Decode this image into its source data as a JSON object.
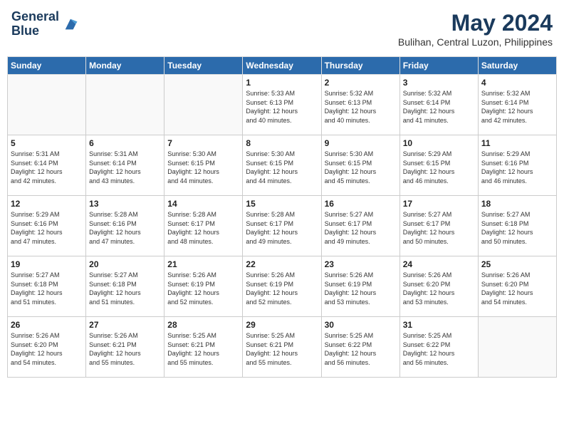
{
  "header": {
    "logo_line1": "General",
    "logo_line2": "Blue",
    "month": "May 2024",
    "location": "Bulihan, Central Luzon, Philippines"
  },
  "days_of_week": [
    "Sunday",
    "Monday",
    "Tuesday",
    "Wednesday",
    "Thursday",
    "Friday",
    "Saturday"
  ],
  "weeks": [
    [
      {
        "day": "",
        "info": ""
      },
      {
        "day": "",
        "info": ""
      },
      {
        "day": "",
        "info": ""
      },
      {
        "day": "1",
        "info": "Sunrise: 5:33 AM\nSunset: 6:13 PM\nDaylight: 12 hours\nand 40 minutes."
      },
      {
        "day": "2",
        "info": "Sunrise: 5:32 AM\nSunset: 6:13 PM\nDaylight: 12 hours\nand 40 minutes."
      },
      {
        "day": "3",
        "info": "Sunrise: 5:32 AM\nSunset: 6:14 PM\nDaylight: 12 hours\nand 41 minutes."
      },
      {
        "day": "4",
        "info": "Sunrise: 5:32 AM\nSunset: 6:14 PM\nDaylight: 12 hours\nand 42 minutes."
      }
    ],
    [
      {
        "day": "5",
        "info": "Sunrise: 5:31 AM\nSunset: 6:14 PM\nDaylight: 12 hours\nand 42 minutes."
      },
      {
        "day": "6",
        "info": "Sunrise: 5:31 AM\nSunset: 6:14 PM\nDaylight: 12 hours\nand 43 minutes."
      },
      {
        "day": "7",
        "info": "Sunrise: 5:30 AM\nSunset: 6:15 PM\nDaylight: 12 hours\nand 44 minutes."
      },
      {
        "day": "8",
        "info": "Sunrise: 5:30 AM\nSunset: 6:15 PM\nDaylight: 12 hours\nand 44 minutes."
      },
      {
        "day": "9",
        "info": "Sunrise: 5:30 AM\nSunset: 6:15 PM\nDaylight: 12 hours\nand 45 minutes."
      },
      {
        "day": "10",
        "info": "Sunrise: 5:29 AM\nSunset: 6:15 PM\nDaylight: 12 hours\nand 46 minutes."
      },
      {
        "day": "11",
        "info": "Sunrise: 5:29 AM\nSunset: 6:16 PM\nDaylight: 12 hours\nand 46 minutes."
      }
    ],
    [
      {
        "day": "12",
        "info": "Sunrise: 5:29 AM\nSunset: 6:16 PM\nDaylight: 12 hours\nand 47 minutes."
      },
      {
        "day": "13",
        "info": "Sunrise: 5:28 AM\nSunset: 6:16 PM\nDaylight: 12 hours\nand 47 minutes."
      },
      {
        "day": "14",
        "info": "Sunrise: 5:28 AM\nSunset: 6:17 PM\nDaylight: 12 hours\nand 48 minutes."
      },
      {
        "day": "15",
        "info": "Sunrise: 5:28 AM\nSunset: 6:17 PM\nDaylight: 12 hours\nand 49 minutes."
      },
      {
        "day": "16",
        "info": "Sunrise: 5:27 AM\nSunset: 6:17 PM\nDaylight: 12 hours\nand 49 minutes."
      },
      {
        "day": "17",
        "info": "Sunrise: 5:27 AM\nSunset: 6:17 PM\nDaylight: 12 hours\nand 50 minutes."
      },
      {
        "day": "18",
        "info": "Sunrise: 5:27 AM\nSunset: 6:18 PM\nDaylight: 12 hours\nand 50 minutes."
      }
    ],
    [
      {
        "day": "19",
        "info": "Sunrise: 5:27 AM\nSunset: 6:18 PM\nDaylight: 12 hours\nand 51 minutes."
      },
      {
        "day": "20",
        "info": "Sunrise: 5:27 AM\nSunset: 6:18 PM\nDaylight: 12 hours\nand 51 minutes."
      },
      {
        "day": "21",
        "info": "Sunrise: 5:26 AM\nSunset: 6:19 PM\nDaylight: 12 hours\nand 52 minutes."
      },
      {
        "day": "22",
        "info": "Sunrise: 5:26 AM\nSunset: 6:19 PM\nDaylight: 12 hours\nand 52 minutes."
      },
      {
        "day": "23",
        "info": "Sunrise: 5:26 AM\nSunset: 6:19 PM\nDaylight: 12 hours\nand 53 minutes."
      },
      {
        "day": "24",
        "info": "Sunrise: 5:26 AM\nSunset: 6:20 PM\nDaylight: 12 hours\nand 53 minutes."
      },
      {
        "day": "25",
        "info": "Sunrise: 5:26 AM\nSunset: 6:20 PM\nDaylight: 12 hours\nand 54 minutes."
      }
    ],
    [
      {
        "day": "26",
        "info": "Sunrise: 5:26 AM\nSunset: 6:20 PM\nDaylight: 12 hours\nand 54 minutes."
      },
      {
        "day": "27",
        "info": "Sunrise: 5:26 AM\nSunset: 6:21 PM\nDaylight: 12 hours\nand 55 minutes."
      },
      {
        "day": "28",
        "info": "Sunrise: 5:25 AM\nSunset: 6:21 PM\nDaylight: 12 hours\nand 55 minutes."
      },
      {
        "day": "29",
        "info": "Sunrise: 5:25 AM\nSunset: 6:21 PM\nDaylight: 12 hours\nand 55 minutes."
      },
      {
        "day": "30",
        "info": "Sunrise: 5:25 AM\nSunset: 6:22 PM\nDaylight: 12 hours\nand 56 minutes."
      },
      {
        "day": "31",
        "info": "Sunrise: 5:25 AM\nSunset: 6:22 PM\nDaylight: 12 hours\nand 56 minutes."
      },
      {
        "day": "",
        "info": ""
      }
    ]
  ]
}
